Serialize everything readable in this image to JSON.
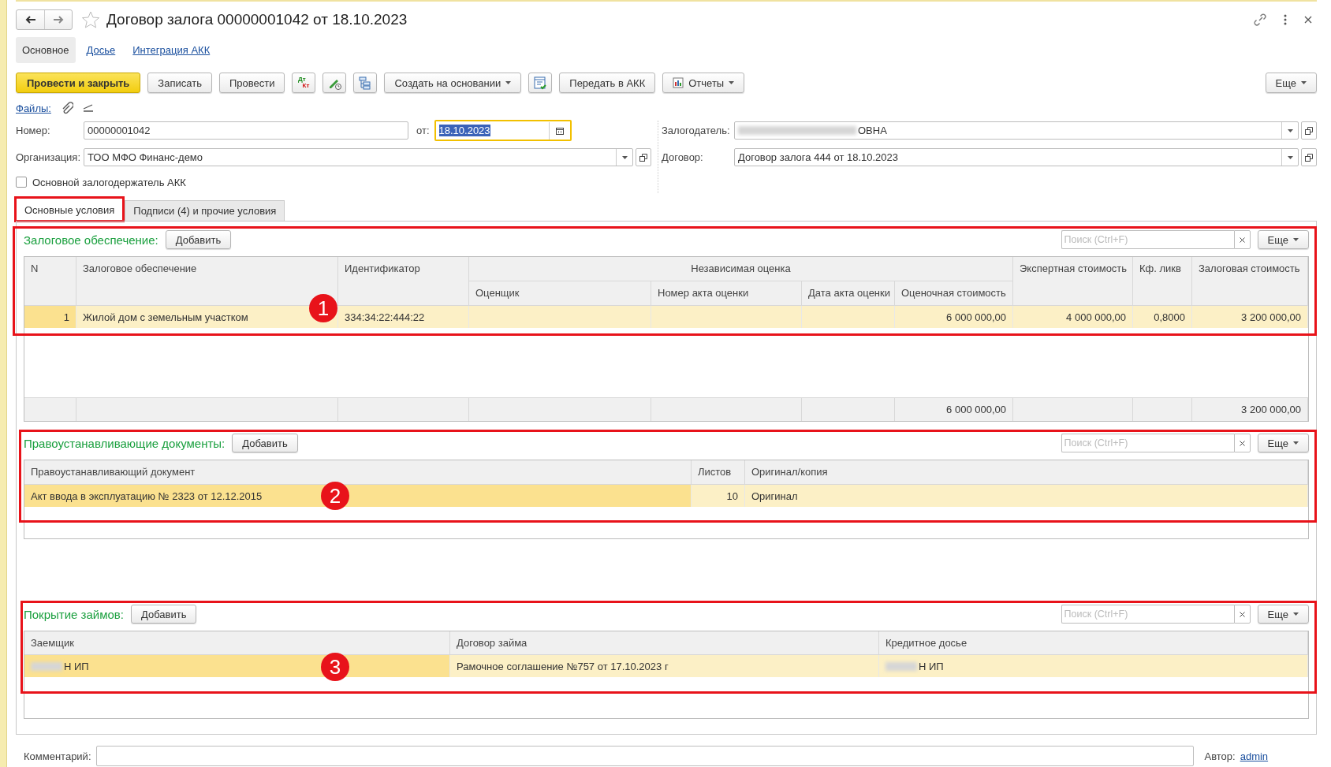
{
  "window": {
    "title": "Договор залога 00000001042 от 18.10.2023",
    "starred": false
  },
  "nav_tabs": [
    {
      "label": "Основное",
      "selected": true
    },
    {
      "label": "Досье",
      "selected": false
    },
    {
      "label": "Интеграция АКК",
      "selected": false
    }
  ],
  "toolbar": [
    {
      "kind": "primary",
      "label": "Провести и закрыть"
    },
    {
      "kind": "button",
      "label": "Записать"
    },
    {
      "kind": "button",
      "label": "Провести"
    },
    {
      "kind": "dtkt",
      "top": "Дт",
      "bottom": "Кт"
    },
    {
      "kind": "icon"
    },
    {
      "kind": "icon"
    },
    {
      "kind": "menu",
      "label": "Создать на основании"
    },
    {
      "kind": "icon"
    },
    {
      "kind": "button",
      "label": "Передать в АКК"
    },
    {
      "kind": "menu",
      "label": "Отчеты",
      "icon": true
    },
    {
      "kind": "spacer"
    },
    {
      "kind": "menu",
      "label": "Еще"
    }
  ],
  "files_link": "Файлы:",
  "fields": {
    "number": {
      "label": "Номер:",
      "value": "00000001042"
    },
    "date": {
      "label": "от:",
      "value": "18.10.2023",
      "focused": true
    },
    "organization": {
      "label": "Организация:",
      "value": "ТОО МФО Финанс-демо"
    },
    "pledger": {
      "label": "Залогодатель:",
      "value": "ОВНА",
      "redacted": true
    },
    "contract": {
      "label": "Договор:",
      "value": "Договор залога 444 от 18.10.2023"
    }
  },
  "main_pledgee": {
    "label": "Основной залогодержатель АКК",
    "checked": false
  },
  "form_tabs": [
    {
      "label": "Основные условия",
      "selected": true,
      "highlighted": true
    },
    {
      "label": "Подписи (4) и прочие условия",
      "selected": false,
      "highlighted": false
    }
  ],
  "sections": [
    {
      "title": "Залоговое обеспечение:",
      "add_button": "Добавить",
      "search": {
        "placeholder": "Поиск (Ctrl+F)"
      },
      "more": "Еще",
      "annotation": "1",
      "header_group": {
        "label": "Независимая оценка"
      },
      "columns": [
        {
          "label": "N",
          "numeric": true,
          "grouped": false
        },
        {
          "label": "Залоговое обеспечение",
          "numeric": false,
          "grouped": false
        },
        {
          "label": "Идентификатор",
          "numeric": false,
          "grouped": false
        },
        {
          "label": "Оценщик",
          "grouped": true
        },
        {
          "label": "Номер акта оценки",
          "grouped": true
        },
        {
          "label": "Дата акта оценки",
          "grouped": true
        },
        {
          "label": "Оценочная стоимость",
          "numeric": true,
          "grouped": true,
          "total": "6 000 000,00"
        },
        {
          "label": "Экспертная стоимость",
          "numeric": true,
          "grouped": false
        },
        {
          "label": "Кф. ликв",
          "numeric": true,
          "grouped": false
        },
        {
          "label": "Залоговая стоимость",
          "numeric": true,
          "grouped": false,
          "total": "3 200 000,00"
        }
      ],
      "rows": [
        {
          "selected": true,
          "cells": [
            {
              "text": "1",
              "focused": true
            },
            {
              "text": "Жилой дом с земельным участком",
              "focused": false
            },
            {
              "text": "334:34:22:444:22",
              "focused": false
            },
            {
              "text": "",
              "focused": false
            },
            {
              "text": "",
              "focused": false
            },
            {
              "text": "",
              "focused": false
            },
            {
              "text": "6 000 000,00",
              "focused": false
            },
            {
              "text": "4 000 000,00",
              "focused": false
            },
            {
              "text": "0,8000",
              "focused": false
            },
            {
              "text": "3 200 000,00",
              "focused": false
            }
          ]
        }
      ],
      "totals": true
    },
    {
      "title": "Правоустанавливающие документы:",
      "add_button": "Добавить",
      "search": {
        "placeholder": "Поиск (Ctrl+F)"
      },
      "more": "Еще",
      "annotation": "2",
      "columns": [
        {
          "label": "Правоустанавливающий документ",
          "numeric": false
        },
        {
          "label": "Листов",
          "numeric": true
        },
        {
          "label": "Оригинал/копия",
          "numeric": false
        }
      ],
      "rows": [
        {
          "selected": true,
          "cells": [
            {
              "text": "Акт ввода в эксплуатацию № 2323 от 12.12.2015",
              "focused": true
            },
            {
              "text": "10",
              "focused": false
            },
            {
              "text": "Оригинал",
              "focused": false
            }
          ]
        }
      ],
      "totals": false
    },
    {
      "title": "Покрытие займов:",
      "add_button": "Добавить",
      "search": {
        "placeholder": "Поиск (Ctrl+F)"
      },
      "more": "Еще",
      "annotation": "3",
      "columns": [
        {
          "label": "Заемщик",
          "numeric": false
        },
        {
          "label": "Договор займа",
          "numeric": false
        },
        {
          "label": "Кредитное досье",
          "numeric": false
        }
      ],
      "rows": [
        {
          "selected": true,
          "cells": [
            {
              "text": "Н ИП",
              "focused": true,
              "redacted": true
            },
            {
              "text": "Рамочное соглашение №757 от 17.10.2023 г",
              "focused": false
            },
            {
              "text": "Н ИП",
              "focused": false,
              "redacted": true
            }
          ]
        }
      ],
      "totals": false
    }
  ],
  "comment": {
    "label": "Комментарий:"
  },
  "author": {
    "label": "Автор:",
    "value": "admin"
  }
}
